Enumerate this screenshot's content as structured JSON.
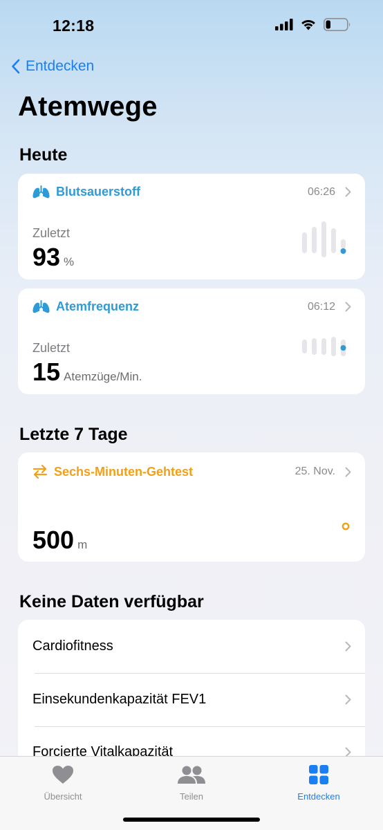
{
  "status": {
    "time": "12:18"
  },
  "nav": {
    "back_label": "Entdecken",
    "title": "Atemwege"
  },
  "sections": {
    "today": "Heute",
    "last7": "Letzte 7 Tage",
    "nodata": "Keine Daten verfügbar"
  },
  "cards": {
    "oxygen": {
      "name": "Blutsauerstoff",
      "time": "06:26",
      "label": "Zuletzt",
      "value": "93",
      "unit": "%"
    },
    "resp": {
      "name": "Atemfrequenz",
      "time": "06:12",
      "label": "Zuletzt",
      "value": "15",
      "unit": "Atemzüge/Min."
    },
    "walk": {
      "name": "Sechs-Minuten-Gehtest",
      "time": "25. Nov.",
      "value": "500",
      "unit": "m"
    }
  },
  "nodata_items": [
    "Cardiofitness",
    "Einsekundenkapazität FEV1",
    "Forcierte Vitalkapazität"
  ],
  "tabs": [
    "Übersicht",
    "Teilen",
    "Entdecken"
  ],
  "colors": {
    "accent": "#1a7ff2",
    "respiratory": "#2f9bd6",
    "mobility": "#f2a017"
  }
}
